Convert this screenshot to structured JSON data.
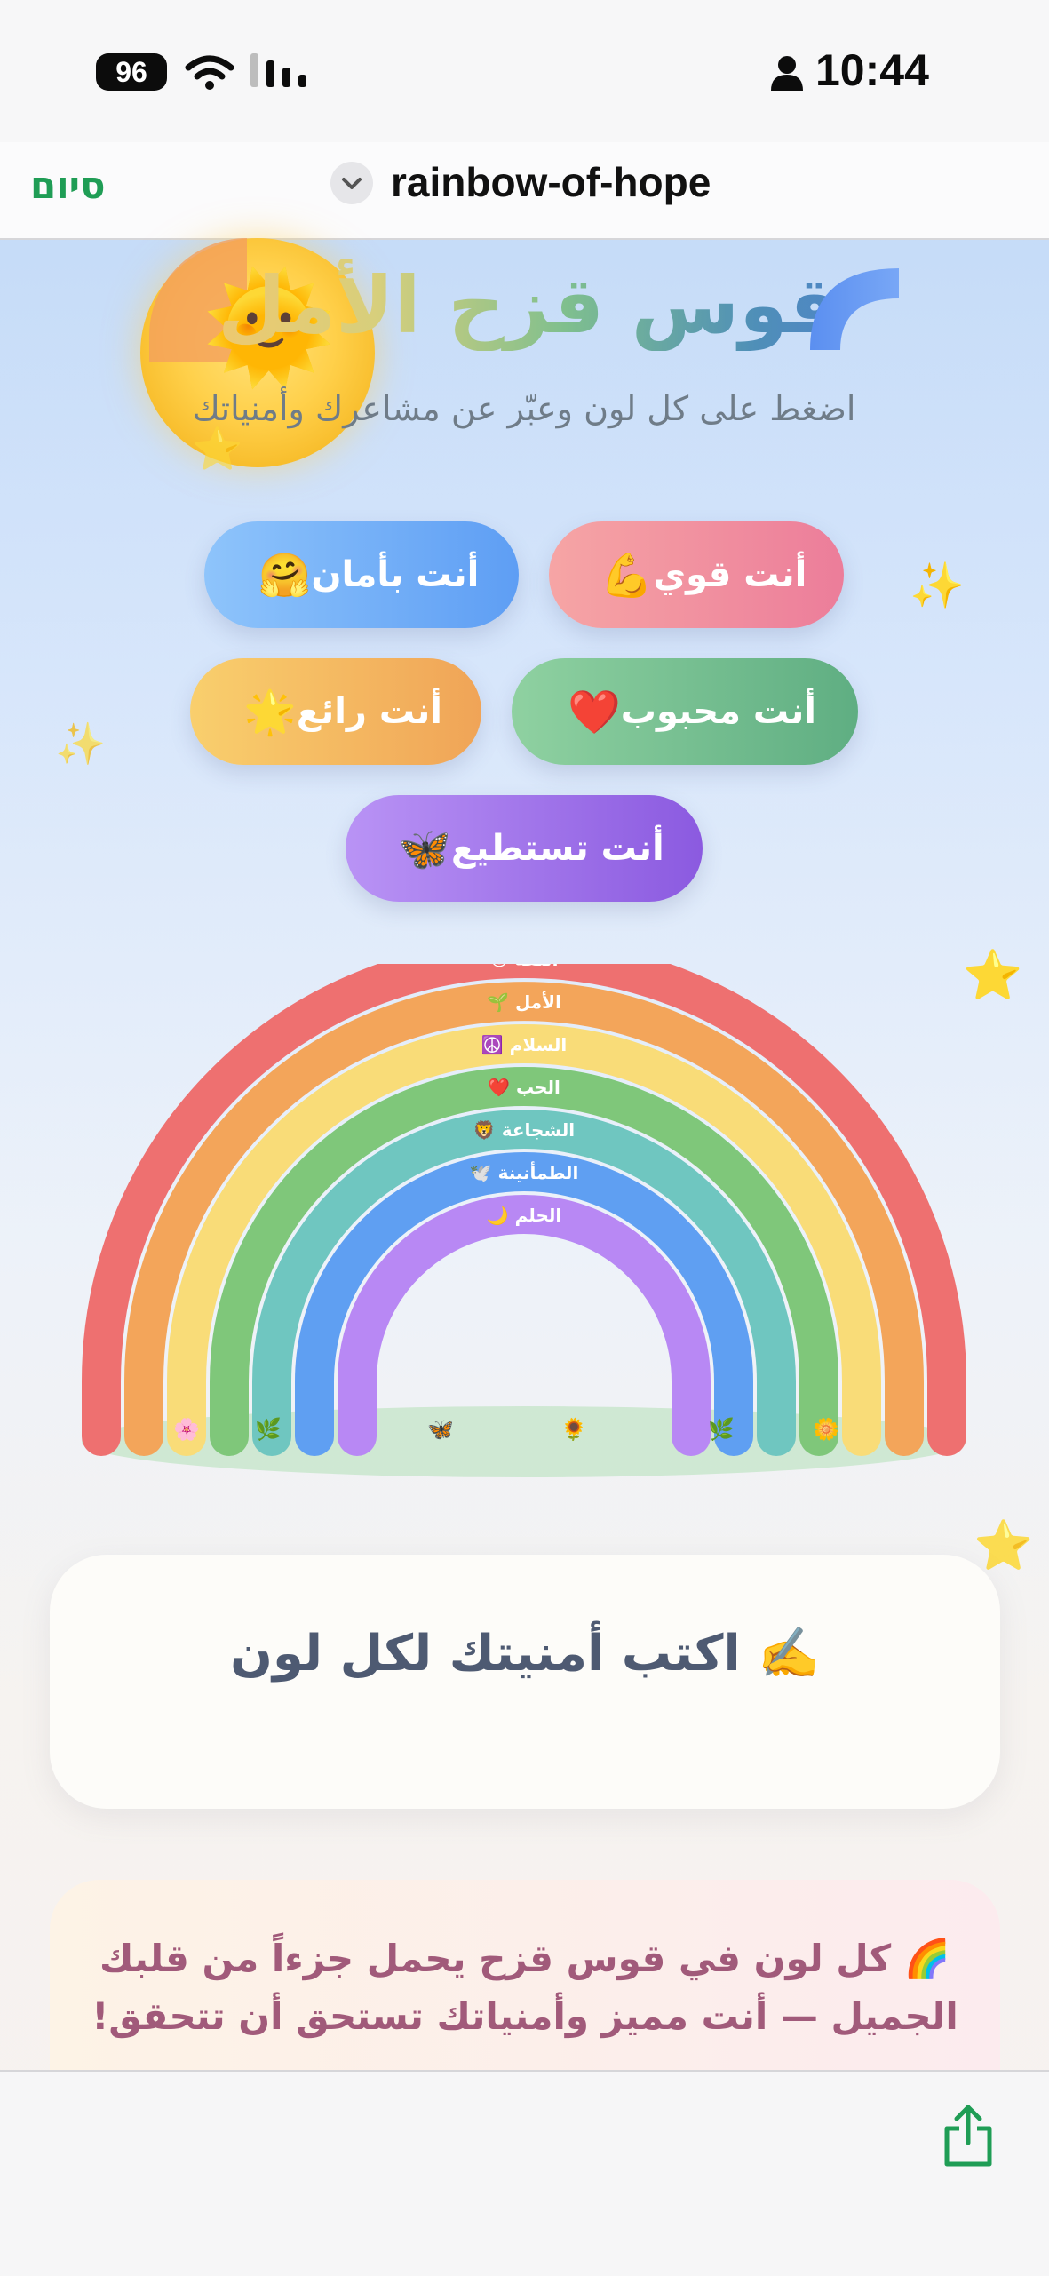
{
  "status_bar": {
    "battery": "96",
    "time": "10:44"
  },
  "nav": {
    "done_label": "סיום",
    "title": "rainbow-of-hope"
  },
  "header": {
    "title": "قوس قزح الأمل",
    "subtitle": "اضغط على كل لون وعبّر عن مشاعرك وأمنياتك"
  },
  "buttons": [
    {
      "label": "أنت قوي",
      "emoji": "💪"
    },
    {
      "label": "أنت بأمان",
      "emoji": "🤗"
    },
    {
      "label": "أنت محبوب",
      "emoji": "❤️"
    },
    {
      "label": "أنت رائع",
      "emoji": "🌟"
    },
    {
      "label": "أنت تستطيع",
      "emoji": "🦋"
    }
  ],
  "rainbow": {
    "bands": [
      {
        "label": "الثقة",
        "emoji": "😊",
        "color": "#ee7070"
      },
      {
        "label": "الأمل",
        "emoji": "🌱",
        "color": "#f3a55a"
      },
      {
        "label": "السلام",
        "emoji": "☮️",
        "color": "#f9dc78"
      },
      {
        "label": "الحب",
        "emoji": "❤️",
        "color": "#7fc77a"
      },
      {
        "label": "الشجاعة",
        "emoji": "🦁",
        "color": "#6fc6c0"
      },
      {
        "label": "الطمأنينة",
        "emoji": "🕊️",
        "color": "#5f9ff2"
      },
      {
        "label": "الحلم",
        "emoji": "🌙",
        "color": "#b888f4"
      }
    ],
    "ground_emojis": [
      "🌸",
      "🌿",
      "🦋",
      "🌻",
      "🌿",
      "🌼"
    ]
  },
  "wish_card": {
    "title": "✍️ اكتب أمنيتك لكل لون"
  },
  "message": {
    "text": "🌈 كل لون في قوس قزح يحمل جزءاً من قلبك الجميل — أنت مميز وأمنياتك تستحق أن تتحقق!"
  },
  "colors": {
    "accent_green": "#1f9d55"
  }
}
